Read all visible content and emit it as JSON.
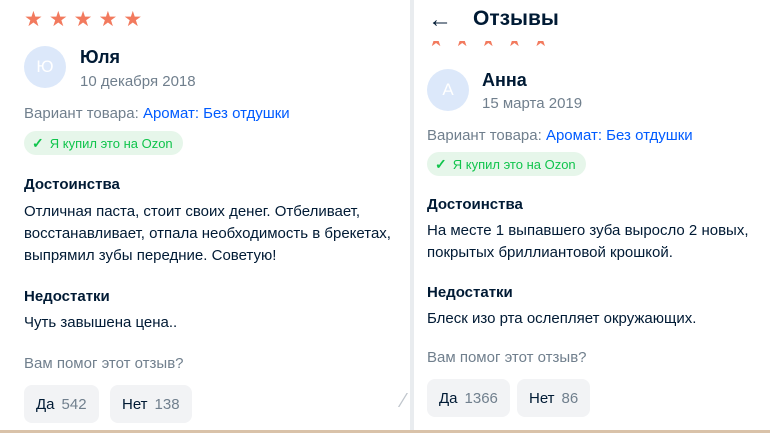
{
  "left": {
    "stars": 5,
    "avatar_letter": "Ю",
    "name": "Юля",
    "date": "10 декабря 2018",
    "variant_label": "Вариант товара:",
    "variant_value": "Аромат: Без отдушки",
    "badge": "Я купил это на Ozon",
    "pros_title": "Достоинства",
    "pros_lines": [
      "Отличная паста, стоит своих денег. Отбеливает,",
      "восстанавливает, отпала необходимость в брекетах,",
      "выпрямил зубы передние. Советую!"
    ],
    "cons_title": "Недостатки",
    "cons_text": "Чуть завышена цена..",
    "helpful_question": "Вам помог этот отзыв?",
    "yes_label": "Да",
    "yes_count": "542",
    "no_label": "Нет",
    "no_count": "138"
  },
  "right": {
    "header_title": "Отзывы",
    "stars": 5,
    "avatar_letter": "А",
    "name": "Анна",
    "date": "15 марта 2019",
    "variant_label": "Вариант товара:",
    "variant_value": "Аромат: Без отдушки",
    "badge": "Я купил это на Ozon",
    "pros_title": "Достоинства",
    "pros_lines": [
      "На месте 1 выпавшего зуба выросло 2 новых,",
      "покрытых бриллиантовой крошкой."
    ],
    "cons_title": "Недостатки",
    "cons_text": "Блеск изо рта ослепляет окружающих.",
    "helpful_question": "Вам помог этот отзыв?",
    "yes_label": "Да",
    "yes_count": "1366",
    "no_label": "Нет",
    "no_count": "86"
  },
  "colors": {
    "star": "#f27a5e",
    "link": "#005bff",
    "badge_text": "#10c44c",
    "badge_bg": "#e6f6ea",
    "muted": "#707f8d"
  },
  "icons": {
    "star": "star-icon",
    "check": "check-icon",
    "back": "arrow-left-icon"
  }
}
